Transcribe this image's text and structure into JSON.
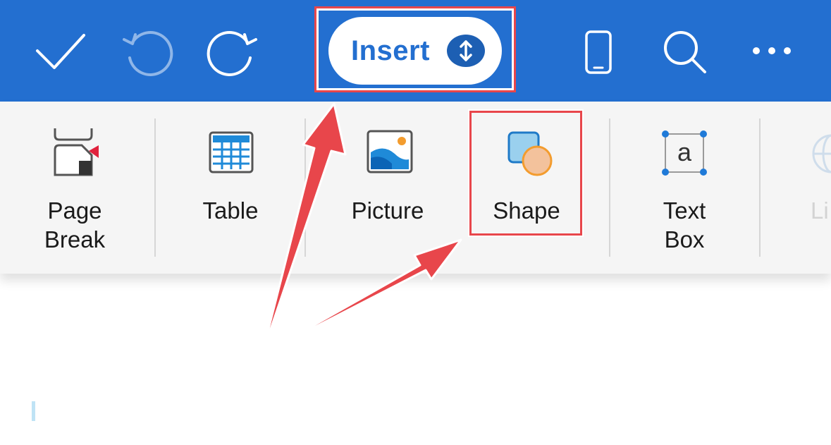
{
  "toolbar": {
    "background_color": "#236fd0",
    "icons": {
      "done": "checkmark-icon",
      "undo": "undo-icon",
      "redo": "redo-icon",
      "view": "phone-icon",
      "search": "search-icon",
      "more": "more-icon"
    },
    "insert_tab": {
      "label": "Insert",
      "toggle_icon": "up-down-arrow-icon"
    }
  },
  "ribbon": {
    "items": [
      {
        "label_line1": "Page",
        "label_line2": "Break",
        "icon": "page-break-icon"
      },
      {
        "label_line1": "Table",
        "label_line2": "",
        "icon": "table-icon"
      },
      {
        "label_line1": "Picture",
        "label_line2": "",
        "icon": "picture-icon"
      },
      {
        "label_line1": "Shape",
        "label_line2": "",
        "icon": "shape-icon"
      },
      {
        "label_line1": "Text",
        "label_line2": "Box",
        "icon": "text-box-icon"
      },
      {
        "label_line1": "Li",
        "label_line2": "",
        "icon": "link-icon"
      }
    ]
  },
  "annotations": {
    "highlight_color": "#e8464b",
    "arrow_color": "#e8464b"
  }
}
